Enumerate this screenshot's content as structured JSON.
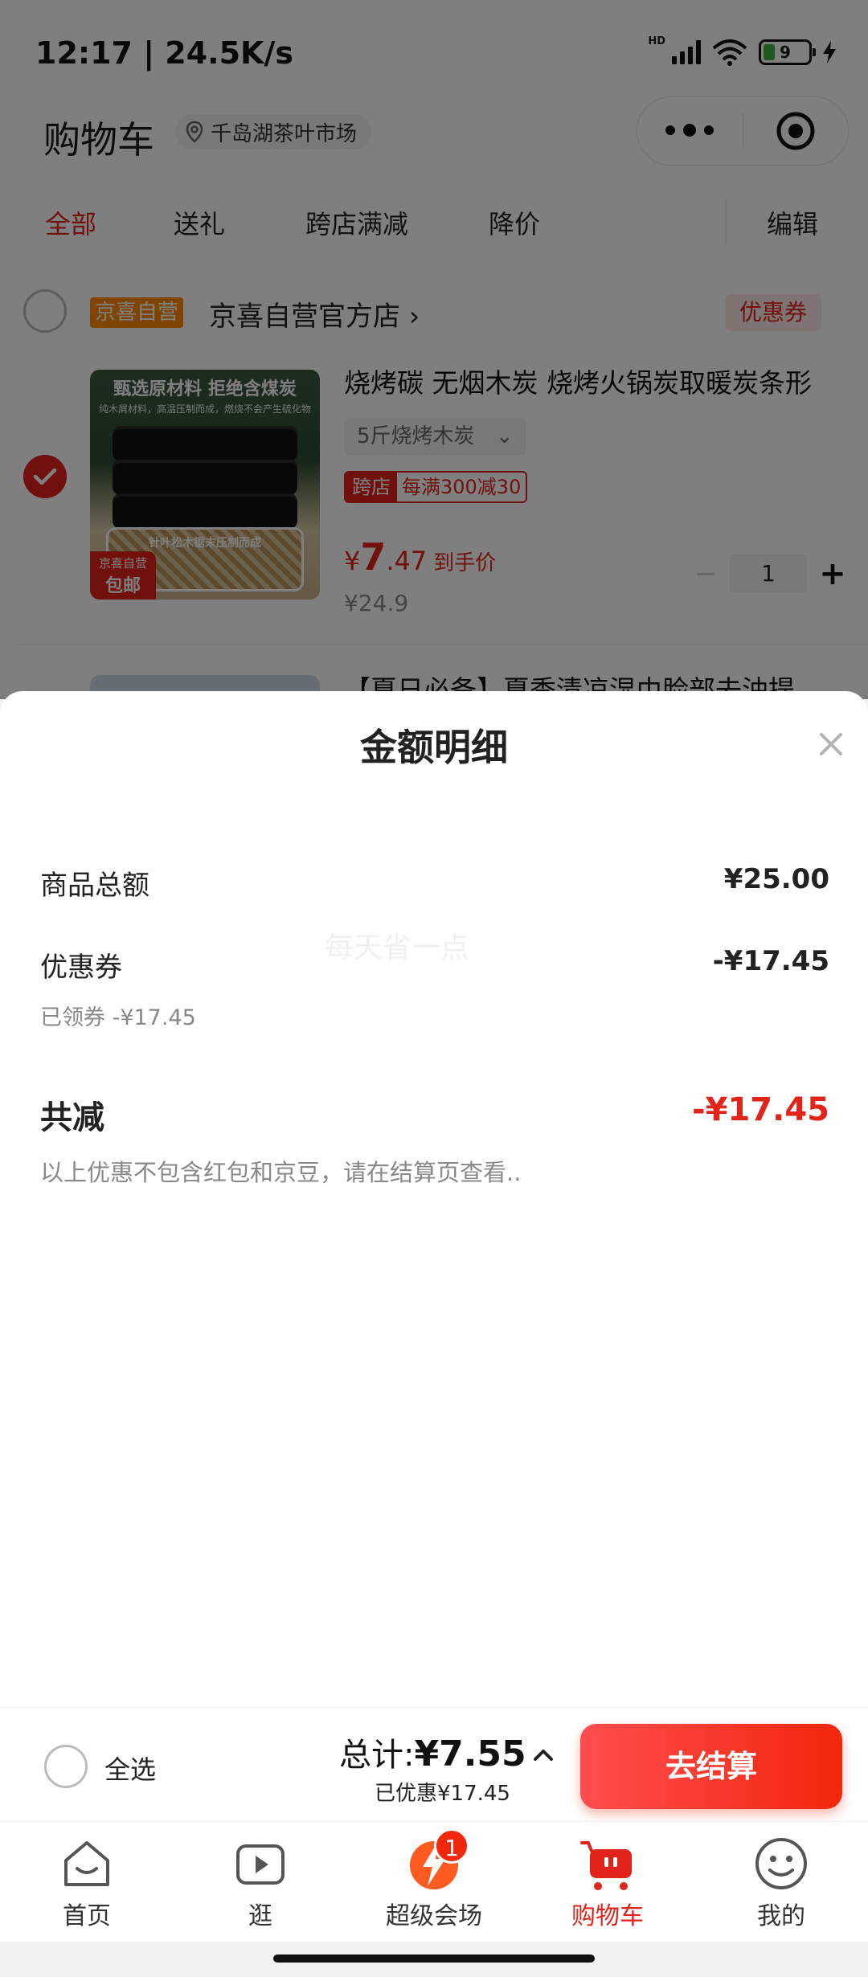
{
  "status": {
    "time": "12:17 | 24.5K/s",
    "hd": "HD",
    "battery": "9"
  },
  "header": {
    "title": "购物车",
    "location": "千岛湖茶叶市场"
  },
  "tabs": [
    "全部",
    "送礼",
    "跨店满减",
    "降价",
    "编辑"
  ],
  "store": {
    "tag": "京喜自营",
    "name": "京喜自营官方店 ›",
    "coupon": "优惠券"
  },
  "product": {
    "title": "烧烤碳 无烟木炭 烧烤火锅炭取暖炭条形",
    "spec": "5斤烧烤木炭",
    "promo_tag": "跨店",
    "promo_text": "每满300减30",
    "price_symbol": "¥",
    "price_int": "7",
    "price_dec": ".47",
    "price_note": "到手价",
    "original_price": "¥24.9",
    "quantity": "1",
    "minus": "−",
    "plus": "+",
    "image_banner": "甄选原材料 拒绝含煤炭",
    "image_sub": "纯木屑材料，高温压制而成，燃烧不会产生硫化物",
    "image_box_text": "针叶松木锯末压制而成",
    "image_ship_top": "京喜自营",
    "image_ship_bottom": "包邮"
  },
  "product2": {
    "title": "【夏日必备】夏季清凉湿巾脸部去油提"
  },
  "sheet": {
    "title": "金额明细",
    "goods_total_label": "商品总额",
    "goods_total_value": "¥25.00",
    "coupon_label": "优惠券",
    "coupon_value": "-¥17.45",
    "coupon_sub": "已领券 -¥17.45",
    "watermark": "每天省一点",
    "total_discount_label": "共减",
    "total_discount_value": "-¥17.45",
    "footnote": "以上优惠不包含红包和京豆，请在结算页查看.."
  },
  "checkout": {
    "select_all": "全选",
    "total_label": "总计:",
    "total_value": "¥7.55",
    "saved": "已优惠¥17.45",
    "pay_button": "去结算"
  },
  "tabbar": {
    "items": [
      {
        "label": "首页",
        "icon": "home-icon"
      },
      {
        "label": "逛",
        "icon": "play-icon"
      },
      {
        "label": "超级会场",
        "icon": "super-venue-icon"
      },
      {
        "label": "购物车",
        "icon": "cart-icon"
      },
      {
        "label": "我的",
        "icon": "smiley-icon"
      }
    ],
    "badge": "1"
  },
  "colors": {
    "brand_red": "#e2231a",
    "orange_tag": "#ff8a00"
  }
}
